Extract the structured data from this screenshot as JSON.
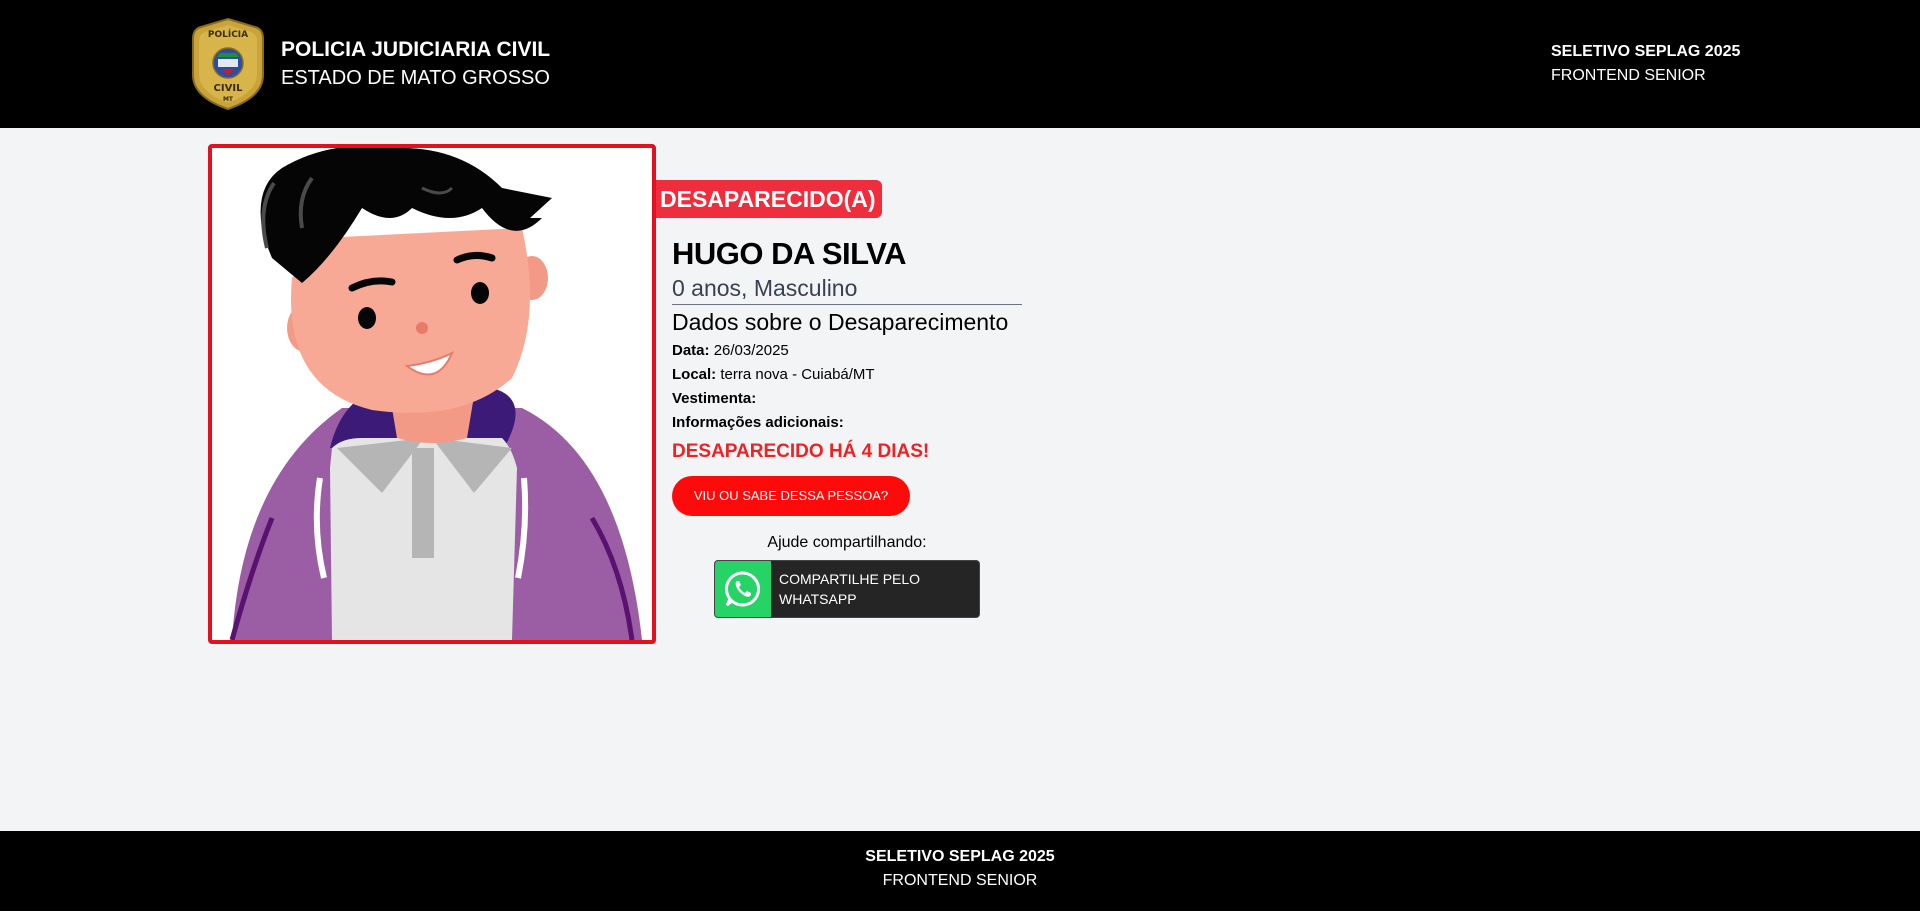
{
  "header": {
    "title": "POLICIA JUDICIARIA CIVIL",
    "subtitle": "ESTADO DE MATO GROSSO",
    "badge_text_top": "POLÍCIA",
    "badge_text_bottom": "CIVIL",
    "badge_text_state": "MT",
    "right_line1": "SELETIVO SEPLAG 2025",
    "right_line2": "FRONTEND SENIOR"
  },
  "person": {
    "status": "DESAPARECIDO(A)",
    "name": "HUGO DA SILVA",
    "age_sex": "0 anos, Masculino",
    "section_title": "Dados sobre o Desaparecimento",
    "date_label": "Data:",
    "date_value": "26/03/2025",
    "location_label": "Local:",
    "location_value": "terra nova - Cuiabá/MT",
    "clothing_label": "Vestimenta:",
    "clothing_value": "",
    "extra_label": "Informações adicionais:",
    "extra_value": "",
    "missing_alert": "DESAPARECIDO HÁ 4 DIAS!"
  },
  "actions": {
    "report_button": "VIU OU SABE DESSA PESSOA?",
    "share_label": "Ajude compartilhando:",
    "whatsapp_line1": "COMPARTILHE PELO",
    "whatsapp_line2": "WHATSAPP"
  },
  "footer": {
    "line1": "SELETIVO SEPLAG 2025",
    "line2": "FRONTEND SENIOR"
  },
  "colors": {
    "accent_red": "#ef2d3c",
    "whatsapp_green": "#25d366",
    "header_bg": "#000000",
    "page_bg": "#f3f4f6"
  },
  "icons": {
    "badge": "police-badge-icon",
    "whatsapp": "whatsapp-icon"
  }
}
